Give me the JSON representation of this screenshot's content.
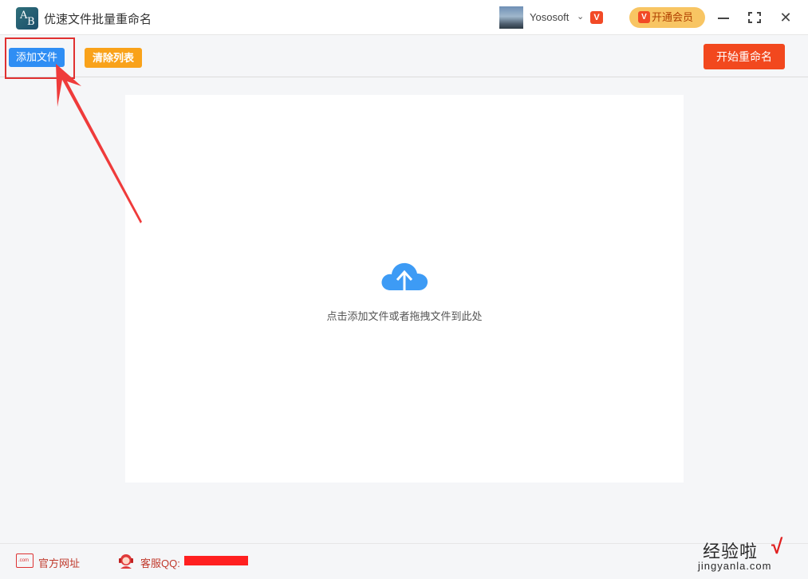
{
  "titlebar": {
    "app_title": "优速文件批量重命名",
    "logo_letter_a": "A",
    "logo_letter_b": "B",
    "username": "Yososoft",
    "user_menu_chevron": "⌄",
    "vip_badge": "V",
    "vip_button_label": "开通会员",
    "window_controls": {
      "minimize_icon": "minimize-icon",
      "maximize_icon": "maximize-icon",
      "close_icon": "close-icon",
      "close_glyph": "✕"
    }
  },
  "toolbar": {
    "add_files_label": "添加文件",
    "clear_list_label": "清除列表",
    "start_rename_label": "开始重命名"
  },
  "dropzone": {
    "hint_text": "点击添加文件或者拖拽文件到此处",
    "icon": "cloud-upload-icon"
  },
  "footer": {
    "website_icon_text": ".com",
    "website_label": "官方网址",
    "support_label": "客服QQ:",
    "watermark_main": "经验啦",
    "watermark_check": "√",
    "watermark_url": "jingyanla.com"
  },
  "colors": {
    "primary_blue": "#2f8ef4",
    "clear_orange": "#f9a21a",
    "start_red": "#f2481e",
    "vip_gold": "#f8c563",
    "annotation_red": "#e03030"
  }
}
